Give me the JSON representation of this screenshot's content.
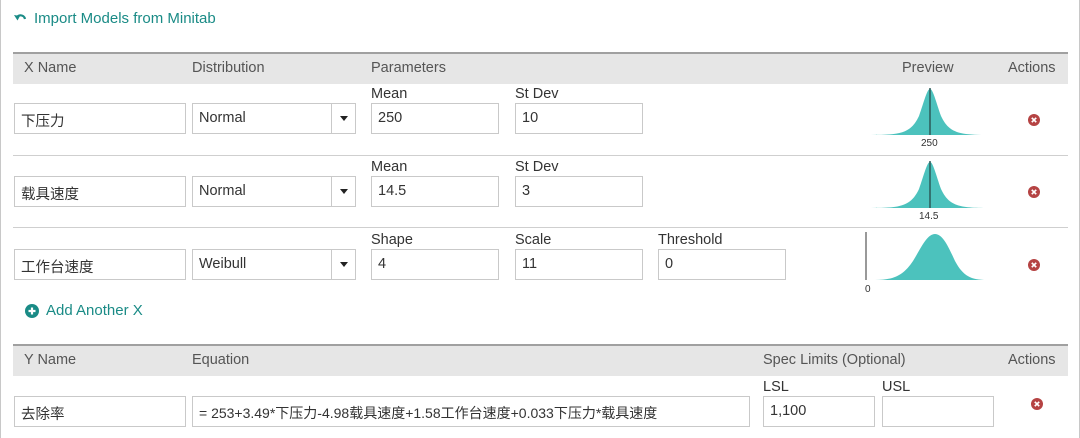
{
  "import_link": "Import Models from Minitab",
  "x_header": {
    "x_name": "X Name",
    "distribution": "Distribution",
    "parameters": "Parameters",
    "preview": "Preview",
    "actions": "Actions"
  },
  "x_rows": [
    {
      "name": "下压力",
      "distribution": "Normal",
      "params": [
        {
          "label": "Mean",
          "value": "250"
        },
        {
          "label": "St Dev",
          "value": "10"
        }
      ],
      "preview_label": "250"
    },
    {
      "name": "载具速度",
      "distribution": "Normal",
      "params": [
        {
          "label": "Mean",
          "value": "14.5"
        },
        {
          "label": "St Dev",
          "value": "3"
        }
      ],
      "preview_label": "14.5"
    },
    {
      "name": "工作台速度",
      "distribution": "Weibull",
      "params": [
        {
          "label": "Shape",
          "value": "4"
        },
        {
          "label": "Scale",
          "value": "11"
        },
        {
          "label": "Threshold",
          "value": "0"
        }
      ],
      "preview_label": "0"
    }
  ],
  "add_link": "Add Another X",
  "y_header": {
    "y_name": "Y Name",
    "equation": "Equation",
    "spec_limits": "Spec Limits (Optional)",
    "actions": "Actions"
  },
  "y_row": {
    "name": "去除率",
    "equation": "=  253+3.49*下压力-4.98载具速度+1.58工作台速度+0.033下压力*载具速度",
    "lsl_label": "LSL",
    "lsl_value": "1,100",
    "usl_label": "USL",
    "usl_value": ""
  },
  "colors": {
    "accent": "#1a8b86",
    "preview_fill": "#4cc2bd",
    "delete_icon": "#b54343"
  },
  "icons": {
    "import": "undo-arrow-icon",
    "add": "plus-circle-icon",
    "delete": "close-circle-icon",
    "dropdown": "triangle-down-icon"
  }
}
